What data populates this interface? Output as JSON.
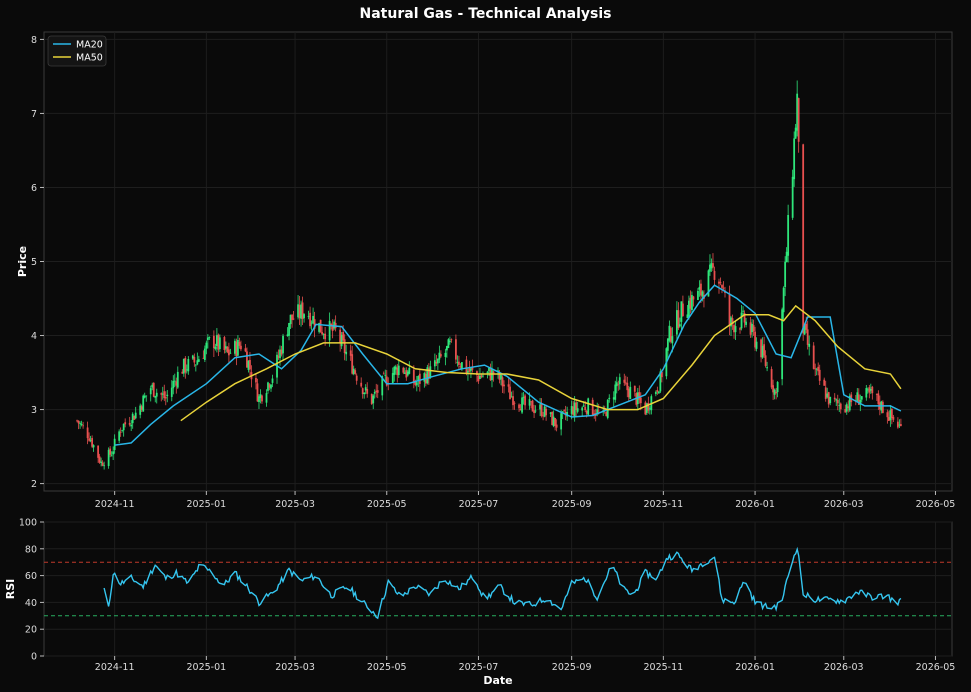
{
  "title": "Natural Gas - Technical Analysis",
  "colors": {
    "background": "#0a0a0a",
    "axes_border": "#3a3a3a",
    "grid": "#1e1e1e",
    "up": "#2ee67a",
    "down": "#e8504f",
    "ma20": "#29b6e8",
    "ma50": "#e8d33a",
    "rsi": "#35c6f0",
    "overbought": "#c0392b",
    "oversold": "#27ae60"
  },
  "chart_data": [
    {
      "type": "candlestick",
      "ylabel": "Price",
      "ylim": [
        1.9,
        8.1
      ],
      "yticks": [
        2,
        3,
        4,
        5,
        6,
        7,
        8
      ],
      "xlim": [
        "2024-09-15",
        "2026-05-12"
      ],
      "xticks": [
        "2024-11",
        "2025-01",
        "2025-03",
        "2025-05",
        "2025-07",
        "2025-09",
        "2025-11",
        "2026-01",
        "2026-03",
        "2026-05"
      ],
      "grid": true,
      "legend": {
        "placement": "top-left",
        "entries": [
          "MA20",
          "MA50"
        ]
      },
      "price_path": [
        [
          "2024-10-07",
          2.85
        ],
        [
          "2024-10-15",
          2.65
        ],
        [
          "2024-10-23",
          2.28
        ],
        [
          "2024-10-30",
          2.42
        ],
        [
          "2024-11-05",
          2.75
        ],
        [
          "2024-11-15",
          2.95
        ],
        [
          "2024-11-25",
          3.3
        ],
        [
          "2024-12-05",
          3.15
        ],
        [
          "2024-12-15",
          3.55
        ],
        [
          "2024-12-25",
          3.65
        ],
        [
          "2025-01-05",
          3.95
        ],
        [
          "2025-01-15",
          3.75
        ],
        [
          "2025-01-25",
          3.9
        ],
        [
          "2025-02-05",
          3.15
        ],
        [
          "2025-02-15",
          3.5
        ],
        [
          "2025-02-25",
          4.2
        ],
        [
          "2025-03-08",
          4.35
        ],
        [
          "2025-03-18",
          4.1
        ],
        [
          "2025-03-28",
          4.05
        ],
        [
          "2025-04-08",
          3.6
        ],
        [
          "2025-04-20",
          3.1
        ],
        [
          "2025-04-30",
          3.4
        ],
        [
          "2025-05-10",
          3.6
        ],
        [
          "2025-05-20",
          3.35
        ],
        [
          "2025-06-01",
          3.55
        ],
        [
          "2025-06-12",
          3.85
        ],
        [
          "2025-06-22",
          3.55
        ],
        [
          "2025-07-01",
          3.45
        ],
        [
          "2025-07-12",
          3.5
        ],
        [
          "2025-07-22",
          3.2
        ],
        [
          "2025-08-01",
          3.05
        ],
        [
          "2025-08-12",
          3.0
        ],
        [
          "2025-08-22",
          2.8
        ],
        [
          "2025-09-01",
          3.0
        ],
        [
          "2025-09-12",
          3.05
        ],
        [
          "2025-09-22",
          2.9
        ],
        [
          "2025-10-01",
          3.35
        ],
        [
          "2025-10-10",
          3.25
        ],
        [
          "2025-10-20",
          3.0
        ],
        [
          "2025-10-30",
          3.4
        ],
        [
          "2025-11-05",
          4.0
        ],
        [
          "2025-11-15",
          4.4
        ],
        [
          "2025-11-25",
          4.55
        ],
        [
          "2025-12-05",
          4.9
        ],
        [
          "2025-12-10",
          4.7
        ],
        [
          "2025-12-15",
          4.15
        ],
        [
          "2025-12-25",
          4.2
        ],
        [
          "2026-01-05",
          3.8
        ],
        [
          "2026-01-15",
          3.2
        ],
        [
          "2026-01-20",
          4.6
        ],
        [
          "2026-01-25",
          6.0
        ],
        [
          "2026-01-29",
          7.2
        ],
        [
          "2026-02-02",
          4.1
        ],
        [
          "2026-02-10",
          3.5
        ],
        [
          "2026-02-20",
          3.1
        ],
        [
          "2026-03-01",
          3.05
        ],
        [
          "2026-03-10",
          3.15
        ],
        [
          "2026-03-20",
          3.2
        ],
        [
          "2026-03-30",
          2.95
        ],
        [
          "2026-04-08",
          2.75
        ]
      ],
      "ma20": [
        [
          "2024-11-01",
          2.52
        ],
        [
          "2024-11-12",
          2.55
        ],
        [
          "2024-11-25",
          2.8
        ],
        [
          "2024-12-10",
          3.05
        ],
        [
          "2025-01-01",
          3.35
        ],
        [
          "2025-01-20",
          3.7
        ],
        [
          "2025-02-05",
          3.75
        ],
        [
          "2025-02-20",
          3.55
        ],
        [
          "2025-03-05",
          3.8
        ],
        [
          "2025-03-15",
          4.15
        ],
        [
          "2025-04-01",
          4.12
        ],
        [
          "2025-04-15",
          3.75
        ],
        [
          "2025-05-01",
          3.35
        ],
        [
          "2025-05-15",
          3.35
        ],
        [
          "2025-06-01",
          3.45
        ],
        [
          "2025-06-20",
          3.55
        ],
        [
          "2025-07-05",
          3.6
        ],
        [
          "2025-07-20",
          3.45
        ],
        [
          "2025-08-10",
          3.1
        ],
        [
          "2025-09-01",
          2.9
        ],
        [
          "2025-09-15",
          2.92
        ],
        [
          "2025-10-01",
          3.05
        ],
        [
          "2025-10-20",
          3.2
        ],
        [
          "2025-11-01",
          3.55
        ],
        [
          "2025-11-15",
          4.15
        ],
        [
          "2025-11-25",
          4.45
        ],
        [
          "2025-12-05",
          4.68
        ],
        [
          "2025-12-20",
          4.5
        ],
        [
          "2026-01-01",
          4.3
        ],
        [
          "2026-01-15",
          3.75
        ],
        [
          "2026-01-25",
          3.7
        ],
        [
          "2026-02-05",
          4.25
        ],
        [
          "2026-02-20",
          4.25
        ],
        [
          "2026-03-01",
          3.2
        ],
        [
          "2026-03-15",
          3.05
        ],
        [
          "2026-04-01",
          3.05
        ],
        [
          "2026-04-08",
          2.98
        ]
      ],
      "ma50": [
        [
          "2024-12-15",
          2.85
        ],
        [
          "2025-01-01",
          3.1
        ],
        [
          "2025-01-20",
          3.35
        ],
        [
          "2025-02-10",
          3.55
        ],
        [
          "2025-03-01",
          3.75
        ],
        [
          "2025-03-20",
          3.9
        ],
        [
          "2025-04-10",
          3.9
        ],
        [
          "2025-05-01",
          3.75
        ],
        [
          "2025-05-20",
          3.55
        ],
        [
          "2025-06-10",
          3.5
        ],
        [
          "2025-07-01",
          3.48
        ],
        [
          "2025-07-20",
          3.48
        ],
        [
          "2025-08-10",
          3.4
        ],
        [
          "2025-09-01",
          3.15
        ],
        [
          "2025-09-25",
          3.0
        ],
        [
          "2025-10-15",
          3.0
        ],
        [
          "2025-11-01",
          3.15
        ],
        [
          "2025-11-20",
          3.6
        ],
        [
          "2025-12-05",
          4.0
        ],
        [
          "2025-12-25",
          4.28
        ],
        [
          "2026-01-10",
          4.28
        ],
        [
          "2026-01-20",
          4.2
        ],
        [
          "2026-01-28",
          4.4
        ],
        [
          "2026-02-10",
          4.2
        ],
        [
          "2026-02-25",
          3.85
        ],
        [
          "2026-03-15",
          3.55
        ],
        [
          "2026-04-01",
          3.48
        ],
        [
          "2026-04-08",
          3.28
        ]
      ]
    },
    {
      "type": "line",
      "ylabel": "RSI",
      "xlabel": "Date",
      "ylim": [
        0,
        100
      ],
      "yticks": [
        0,
        20,
        40,
        60,
        80,
        100
      ],
      "xlim": [
        "2024-09-15",
        "2026-05-12"
      ],
      "xticks": [
        "2024-11",
        "2025-01",
        "2025-03",
        "2025-05",
        "2025-07",
        "2025-09",
        "2025-11",
        "2026-01",
        "2026-03",
        "2026-05"
      ],
      "overbought": 70,
      "oversold": 30,
      "series": [
        {
          "values": [
            [
              "2024-10-25",
              50
            ],
            [
              "2024-10-28",
              35
            ],
            [
              "2024-10-31",
              62
            ],
            [
              "2024-11-05",
              54
            ],
            [
              "2024-11-12",
              58
            ],
            [
              "2024-11-20",
              52
            ],
            [
              "2024-11-28",
              68
            ],
            [
              "2024-12-05",
              58
            ],
            [
              "2024-12-12",
              62
            ],
            [
              "2024-12-20",
              54
            ],
            [
              "2024-12-28",
              68
            ],
            [
              "2025-01-05",
              62
            ],
            [
              "2025-01-12",
              52
            ],
            [
              "2025-01-20",
              62
            ],
            [
              "2025-01-28",
              52
            ],
            [
              "2025-02-05",
              40
            ],
            [
              "2025-02-15",
              48
            ],
            [
              "2025-02-25",
              64
            ],
            [
              "2025-03-05",
              56
            ],
            [
              "2025-03-15",
              60
            ],
            [
              "2025-03-25",
              45
            ],
            [
              "2025-04-05",
              52
            ],
            [
              "2025-04-15",
              40
            ],
            [
              "2025-04-25",
              30
            ],
            [
              "2025-05-02",
              55
            ],
            [
              "2025-05-10",
              44
            ],
            [
              "2025-05-20",
              52
            ],
            [
              "2025-05-30",
              46
            ],
            [
              "2025-06-08",
              58
            ],
            [
              "2025-06-18",
              50
            ],
            [
              "2025-06-28",
              60
            ],
            [
              "2025-07-05",
              42
            ],
            [
              "2025-07-15",
              52
            ],
            [
              "2025-07-25",
              40
            ],
            [
              "2025-08-05",
              38
            ],
            [
              "2025-08-15",
              43
            ],
            [
              "2025-08-25",
              35
            ],
            [
              "2025-09-01",
              54
            ],
            [
              "2025-09-10",
              58
            ],
            [
              "2025-09-18",
              44
            ],
            [
              "2025-09-28",
              68
            ],
            [
              "2025-10-05",
              50
            ],
            [
              "2025-10-12",
              45
            ],
            [
              "2025-10-20",
              62
            ],
            [
              "2025-10-28",
              58
            ],
            [
              "2025-11-03",
              73
            ],
            [
              "2025-11-10",
              76
            ],
            [
              "2025-11-20",
              64
            ],
            [
              "2025-11-28",
              70
            ],
            [
              "2025-12-05",
              74
            ],
            [
              "2025-12-10",
              42
            ],
            [
              "2025-12-18",
              40
            ],
            [
              "2025-12-25",
              56
            ],
            [
              "2026-01-01",
              40
            ],
            [
              "2026-01-10",
              36
            ],
            [
              "2026-01-18",
              38
            ],
            [
              "2026-01-25",
              68
            ],
            [
              "2026-01-29",
              82
            ],
            [
              "2026-02-02",
              46
            ],
            [
              "2026-02-10",
              42
            ],
            [
              "2026-02-20",
              42
            ],
            [
              "2026-03-01",
              41
            ],
            [
              "2026-03-10",
              48
            ],
            [
              "2026-03-20",
              44
            ],
            [
              "2026-03-30",
              45
            ],
            [
              "2026-04-04",
              40
            ],
            [
              "2026-04-08",
              41
            ]
          ]
        }
      ]
    }
  ]
}
